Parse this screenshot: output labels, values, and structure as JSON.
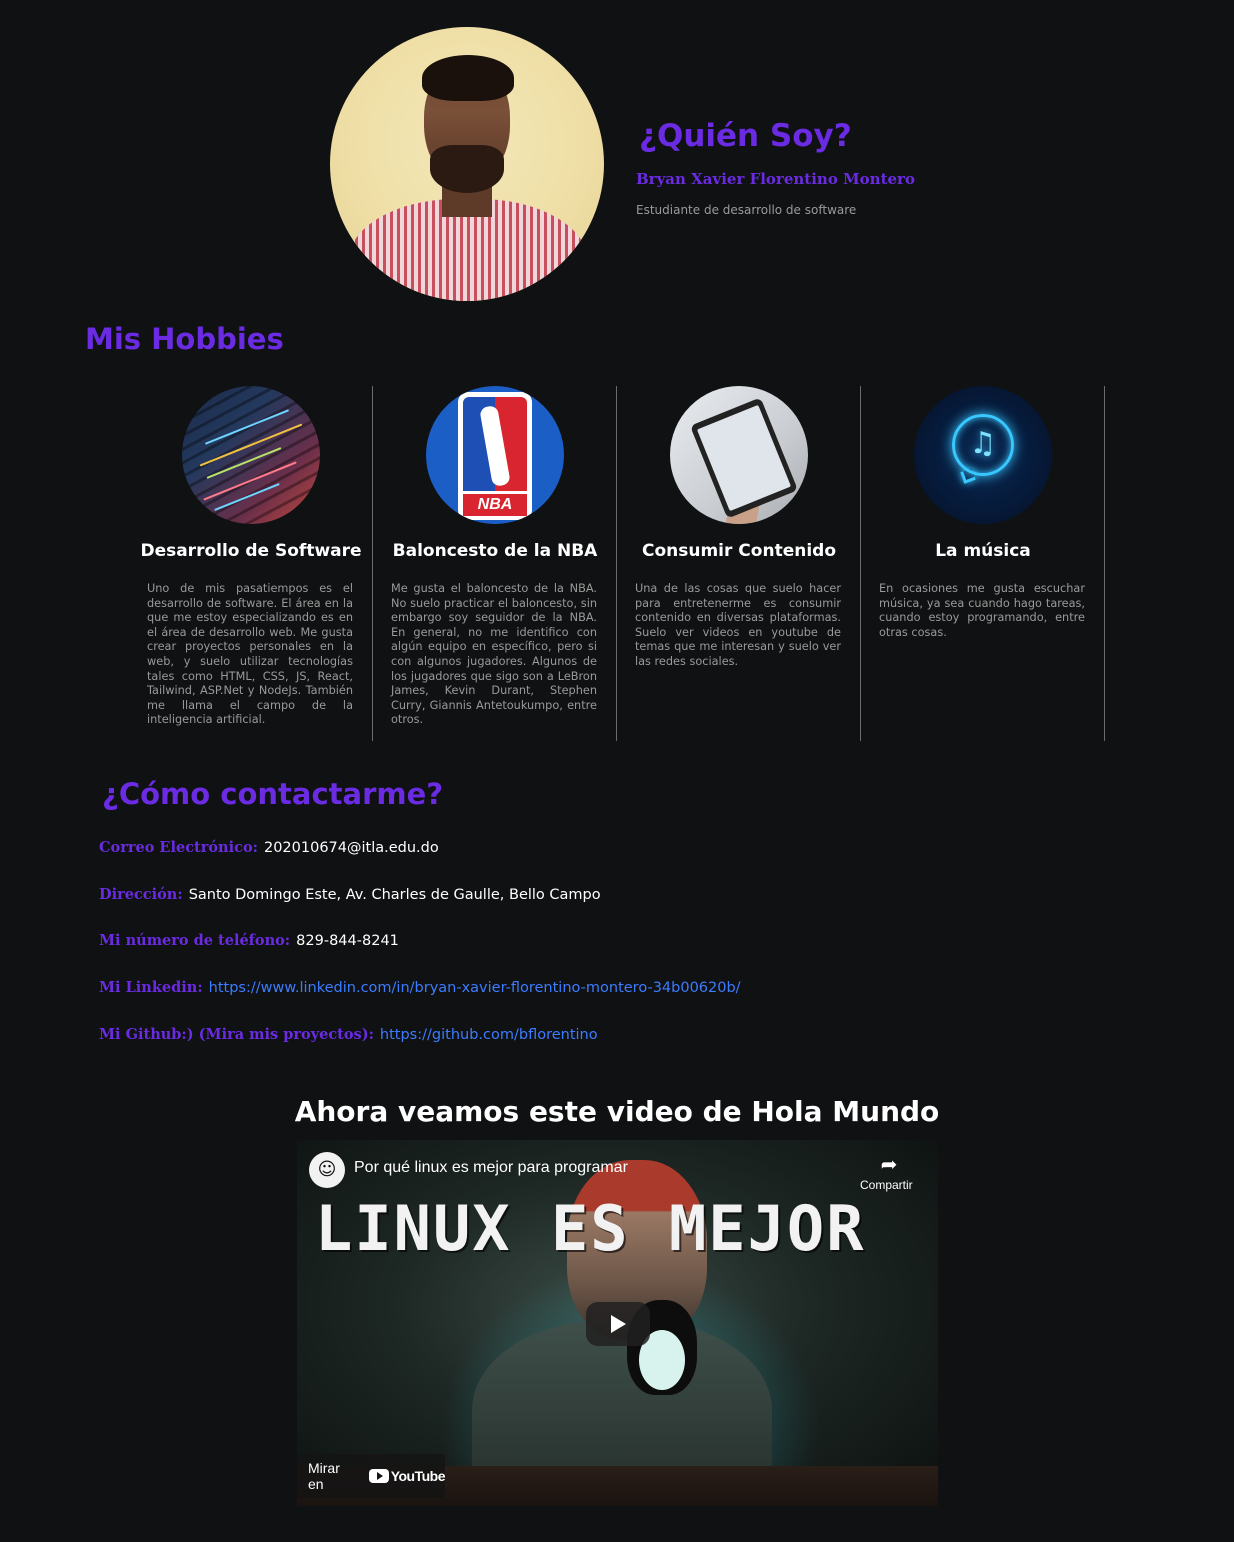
{
  "profile": {
    "heading": "¿Quién Soy?",
    "name": "Bryan Xavier Florentino Montero",
    "role": "Estudiante de desarrollo de software"
  },
  "hobbies": {
    "heading": "Mis Hobbies",
    "items": [
      {
        "title": "Desarrollo de Software",
        "text": "Uno de mis pasatiempos es el desarrollo de software. El área en la que me estoy especializando es en el área de desarrollo web. Me gusta crear proyectos personales en la web, y suelo utilizar tecnologías tales como HTML, CSS, JS, React, Tailwind, ASP.Net y NodeJs. También me llama el campo de la inteligencia artificial."
      },
      {
        "title": "Baloncesto de la NBA",
        "text": "Me gusta el baloncesto de la NBA. No suelo practicar el baloncesto, sin embargo soy seguidor de la NBA. En general, no me identifico con algún equipo en específico, pero si con algunos jugadores. Algunos de los jugadores que sigo son a LeBron James, Kevin Durant, Stephen Curry, Giannis Antetoukumpo, entre otros.",
        "logo_text": "NBA"
      },
      {
        "title": "Consumir Contenido",
        "text": "Una de las cosas que suelo hacer para entretenerme es consumir contenido en diversas plataformas. Suelo ver videos en youtube de temas que me interesan y suelo ver las redes sociales."
      },
      {
        "title": "La música",
        "text": "En ocasiones me gusta escuchar música, ya sea cuando hago tareas, cuando estoy programando, entre otras cosas."
      }
    ]
  },
  "contact": {
    "heading": "¿Cómo contactarme?",
    "email_label": "Correo Electrónico:",
    "email_value": "202010674@itla.edu.do",
    "address_label": "Dirección:",
    "address_value": "Santo Domingo Este, Av. Charles de Gaulle, Bello Campo",
    "phone_label": "Mi número de teléfono:",
    "phone_value": "829-844-8241",
    "linkedin_label": "Mi Linkedin:",
    "linkedin_url": "https://www.linkedin.com/in/bryan-xavier-florentino-montero-34b00620b/",
    "github_label": "Mi Github:) (Mira mis proyectos):",
    "github_url": "https://github.com/bflorentino"
  },
  "video": {
    "heading": "Ahora veamos este video de Hola Mundo",
    "title": "Por qué linux es mejor para programar",
    "thumbnail_text": "LINUX ES MEJOR",
    "share_label": "Compartir",
    "watch_on_label": "Mirar en",
    "platform_label": "YouTube"
  },
  "colors": {
    "background": "#0f1112",
    "accent": "#6a2be2",
    "link": "#3d7cff",
    "muted_text": "#9a9a9a"
  }
}
